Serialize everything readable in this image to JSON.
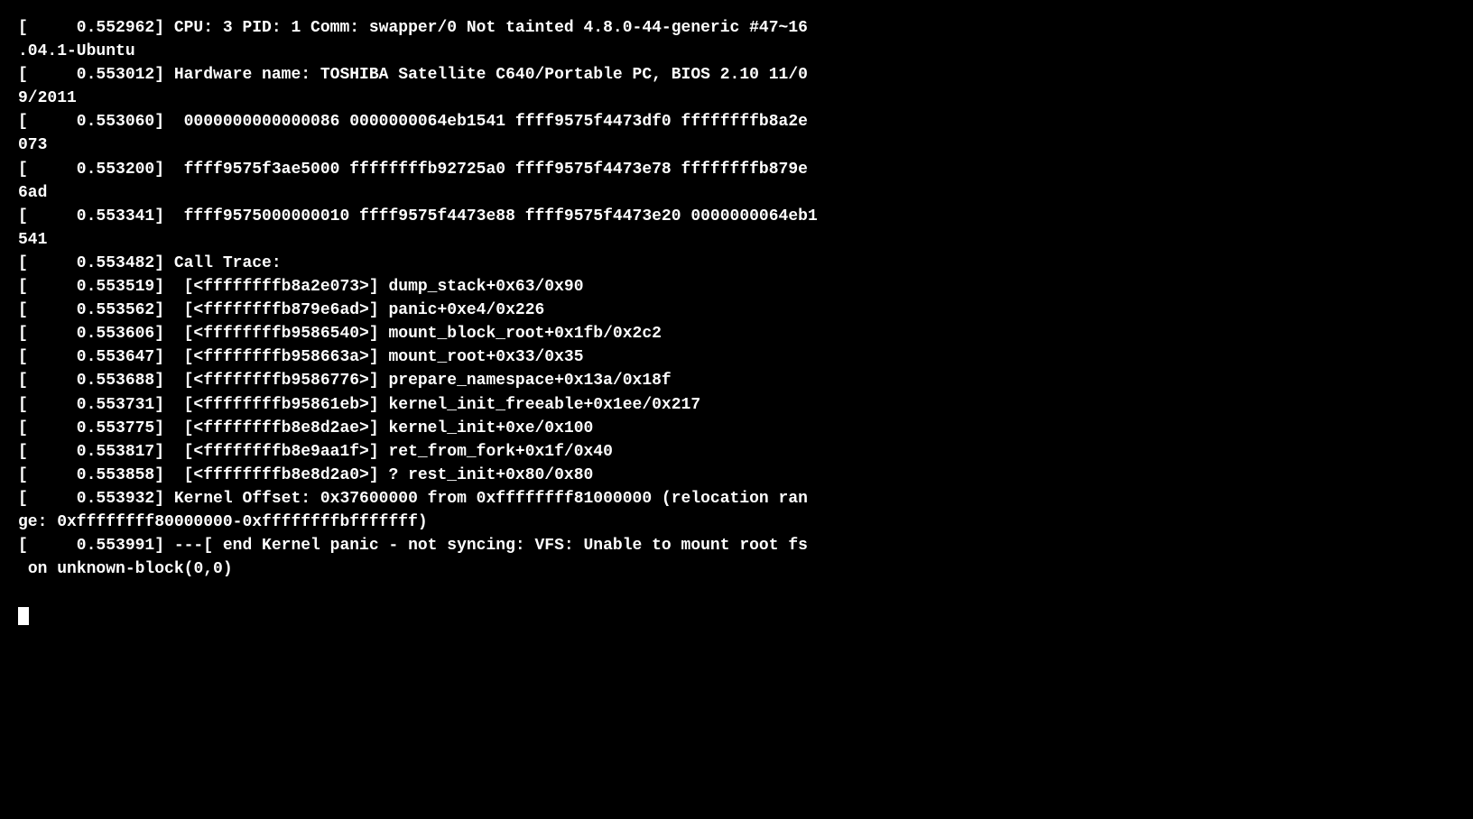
{
  "terminal": {
    "lines": [
      "[     0.552962] CPU: 3 PID: 1 Comm: swapper/0 Not tainted 4.8.0-44-generic #47~16",
      ".04.1-Ubuntu",
      "[     0.553012] Hardware name: TOSHIBA Satellite C640/Portable PC, BIOS 2.10 11/0",
      "9/2011",
      "[     0.553060]  0000000000000086 0000000064eb1541 ffff9575f4473df0 ffffffffb8a2e",
      "073",
      "[     0.553200]  ffff9575f3ae5000 ffffffffb92725a0 ffff9575f4473e78 ffffffffb879e",
      "6ad",
      "[     0.553341]  ffff9575000000010 ffff9575f4473e88 ffff9575f4473e20 0000000064eb1",
      "541",
      "[     0.553482] Call Trace:",
      "[     0.553519]  [<ffffffffb8a2e073>] dump_stack+0x63/0x90",
      "[     0.553562]  [<ffffffffb879e6ad>] panic+0xe4/0x226",
      "[     0.553606]  [<ffffffffb9586540>] mount_block_root+0x1fb/0x2c2",
      "[     0.553647]  [<ffffffffb958663a>] mount_root+0x33/0x35",
      "[     0.553688]  [<ffffffffb9586776>] prepare_namespace+0x13a/0x18f",
      "[     0.553731]  [<ffffffffb95861eb>] kernel_init_freeable+0x1ee/0x217",
      "[     0.553775]  [<ffffffffb8e8d2ae>] kernel_init+0xe/0x100",
      "[     0.553817]  [<ffffffffb8e9aa1f>] ret_from_fork+0x1f/0x40",
      "[     0.553858]  [<ffffffffb8e8d2a0>] ? rest_init+0x80/0x80",
      "[     0.553932] Kernel Offset: 0x37600000 from 0xffffffff81000000 (relocation ran",
      "ge: 0xffffffff80000000-0xffffffffbfffffff)",
      "[     0.553991] ---[ end Kernel panic - not syncing: VFS: Unable to mount root fs",
      " on unknown-block(0,0)"
    ],
    "cursor_visible": true
  }
}
